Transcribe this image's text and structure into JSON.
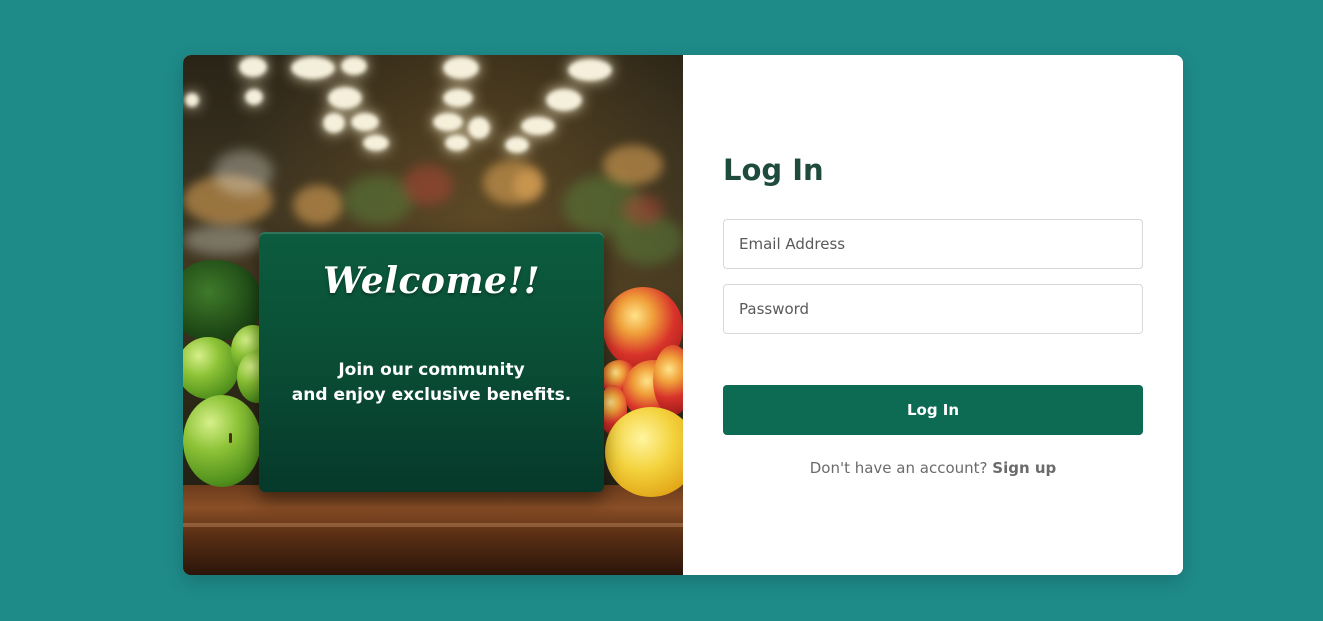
{
  "colors": {
    "page_background": "#1e8b89",
    "title": "#1f4b3f",
    "button": "#0c6b52",
    "sign": "#0a4f36"
  },
  "hero": {
    "heading": "Welcome!!",
    "line1": "Join our community",
    "line2": "and enjoy exclusive benefits."
  },
  "form": {
    "title": "Log In",
    "email_placeholder": "Email Address",
    "password_placeholder": "Password",
    "submit_label": "Log In",
    "signup_prompt": "Don't have an account?",
    "signup_link": "Sign up"
  }
}
